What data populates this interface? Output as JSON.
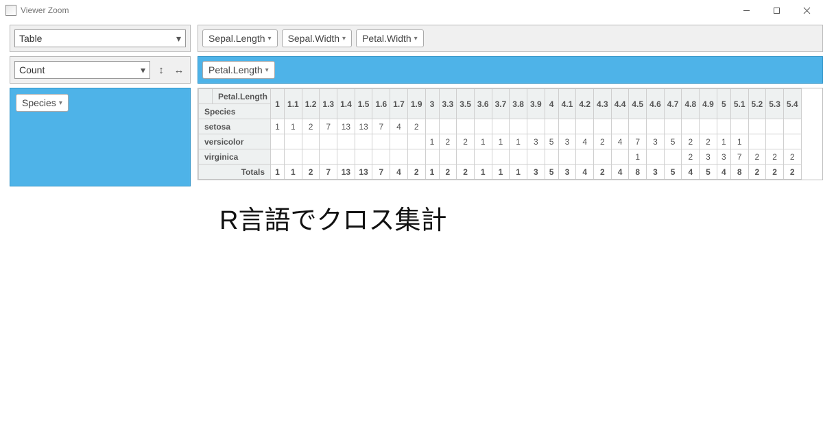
{
  "window": {
    "title": "Viewer Zoom"
  },
  "left": {
    "renderer": {
      "label": "Table"
    },
    "aggregator": {
      "label": "Count"
    },
    "rows_field": {
      "label": "Species"
    }
  },
  "top": {
    "unused_fields": [
      "Sepal.Length",
      "Sepal.Width",
      "Petal.Width"
    ],
    "cols_field": {
      "label": "Petal.Length"
    }
  },
  "pivot": {
    "col_attr_label": "Petal.Length",
    "row_attr_label": "Species",
    "totals_label": "Totals",
    "col_keys": [
      "1",
      "1.1",
      "1.2",
      "1.3",
      "1.4",
      "1.5",
      "1.6",
      "1.7",
      "1.9",
      "3",
      "3.3",
      "3.5",
      "3.6",
      "3.7",
      "3.8",
      "3.9",
      "4",
      "4.1",
      "4.2",
      "4.3",
      "4.4",
      "4.5",
      "4.6",
      "4.7",
      "4.8",
      "4.9",
      "5",
      "5.1",
      "5.2",
      "5.3",
      "5.4"
    ],
    "rows": [
      {
        "key": "setosa",
        "cells": [
          "1",
          "1",
          "2",
          "7",
          "13",
          "13",
          "7",
          "4",
          "2",
          "",
          "",
          "",
          "",
          "",
          "",
          "",
          "",
          "",
          "",
          "",
          "",
          "",
          "",
          "",
          "",
          "",
          "",
          "",
          "",
          "",
          ""
        ]
      },
      {
        "key": "versicolor",
        "cells": [
          "",
          "",
          "",
          "",
          "",
          "",
          "",
          "",
          "",
          "1",
          "2",
          "2",
          "1",
          "1",
          "1",
          "3",
          "5",
          "3",
          "4",
          "2",
          "4",
          "7",
          "3",
          "5",
          "2",
          "2",
          "1",
          "1",
          "",
          "",
          ""
        ]
      },
      {
        "key": "virginica",
        "cells": [
          "",
          "",
          "",
          "",
          "",
          "",
          "",
          "",
          "",
          "",
          "",
          "",
          "",
          "",
          "",
          "",
          "",
          "",
          "",
          "",
          "",
          "1",
          "",
          "",
          "2",
          "3",
          "3",
          "7",
          "2",
          "2",
          "2"
        ]
      }
    ],
    "totals": [
      "1",
      "1",
      "2",
      "7",
      "13",
      "13",
      "7",
      "4",
      "2",
      "1",
      "2",
      "2",
      "1",
      "1",
      "1",
      "3",
      "5",
      "3",
      "4",
      "2",
      "4",
      "8",
      "3",
      "5",
      "4",
      "5",
      "4",
      "8",
      "2",
      "2",
      "2"
    ]
  },
  "caption": "R言語でクロス集計"
}
